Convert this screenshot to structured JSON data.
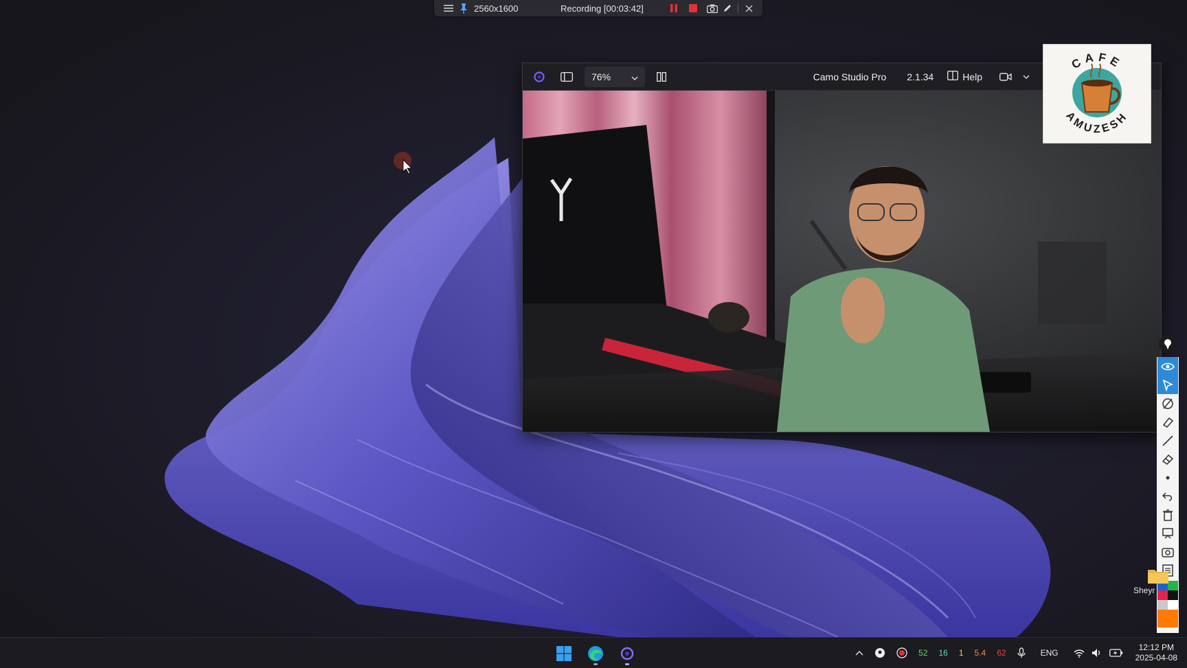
{
  "recorder_bar": {
    "resolution": "2560x1600",
    "status": "Recording [00:03:42]",
    "icons": [
      "menu-icon",
      "pin-icon",
      "pause-icon",
      "stop-icon",
      "camera-icon",
      "pen-icon",
      "close-icon"
    ]
  },
  "camo_window": {
    "zoom_value": "76%",
    "app_title": "Camo Studio Pro",
    "version": "2.1.34",
    "help_label": "Help",
    "icons": [
      "camo-logo-icon",
      "sidebar-toggle-icon",
      "chevron-down-icon",
      "split-view-icon",
      "book-icon",
      "video-camera-icon"
    ]
  },
  "watermark_logo": {
    "top_text": "CAFE",
    "bottom_text": "AMUZESH"
  },
  "annotation_toolbar": {
    "tools": [
      "eye-icon",
      "pointer-icon",
      "pen-icon",
      "highlighter-icon",
      "line-icon",
      "eraser-icon",
      "dot-icon",
      "undo-icon",
      "trash-icon",
      "whiteboard-icon",
      "screenshot-icon",
      "notes-icon"
    ],
    "colors": [
      "#1a63d6",
      "#22b54a",
      "#e0254a",
      "#111111",
      "#c9c9c9",
      "#ff7a00"
    ]
  },
  "desktop_folder": {
    "label": "Sheyr"
  },
  "taskbar": {
    "apps": [
      "windows-start-icon",
      "edge-browser-icon",
      "camo-app-icon"
    ],
    "tray": {
      "stat1": "52",
      "stat2": "16",
      "stat3": "1",
      "stat4": "5.4",
      "stat5": "62",
      "language": "ENG",
      "time": "12:12 PM",
      "date": "2025-04-08"
    }
  }
}
